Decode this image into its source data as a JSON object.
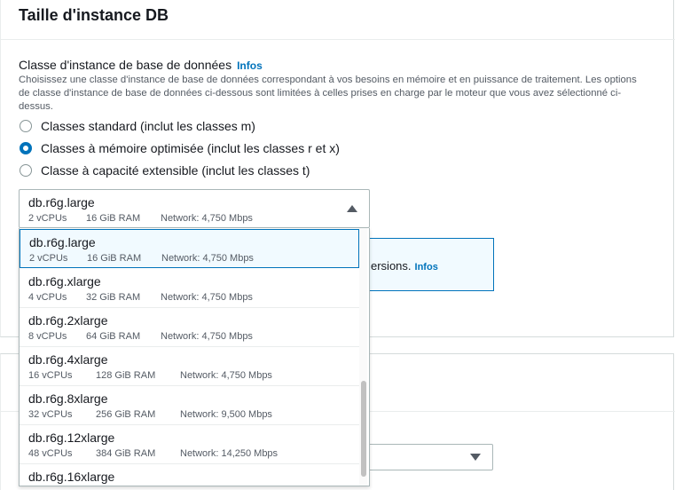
{
  "panel": {
    "title": "Taille d'instance DB",
    "field_label": "Classe d'instance de base de données",
    "info_link": "Infos",
    "description": "Choisissez une classe d'instance de base de données correspondant à vos besoins en mémoire et en puissance de traitement. Les options de classe d'instance de base de données ci-dessous sont limitées à celles prises en charge par le moteur que vous avez sélectionné ci-dessus."
  },
  "radios": [
    {
      "label": "Classes standard (inclut les classes m)",
      "checked": false
    },
    {
      "label": "Classes à mémoire optimisée (inclut les classes r et x)",
      "checked": true
    },
    {
      "label": "Classe à capacité extensible (inclut les classes t)",
      "checked": false
    }
  ],
  "select": {
    "name": "db.r6g.large",
    "vcpu": "2 vCPUs",
    "ram": "16 GiB RAM",
    "network": "Network: 4,750 Mbps"
  },
  "alert": {
    "text": "ersions.",
    "info": "Infos"
  },
  "options": [
    {
      "name": "db.r6g.large",
      "vcpu": "2 vCPUs",
      "ram": "16 GiB RAM",
      "network": "Network: 4,750 Mbps"
    },
    {
      "name": "db.r6g.xlarge",
      "vcpu": "4 vCPUs",
      "ram": "32 GiB RAM",
      "network": "Network: 4,750 Mbps"
    },
    {
      "name": "db.r6g.2xlarge",
      "vcpu": "8 vCPUs",
      "ram": "64 GiB RAM",
      "network": "Network: 4,750 Mbps"
    },
    {
      "name": "db.r6g.4xlarge",
      "vcpu": "16 vCPUs",
      "ram": "128 GiB RAM",
      "network": "Network: 4,750 Mbps"
    },
    {
      "name": "db.r6g.8xlarge",
      "vcpu": "32 vCPUs",
      "ram": "256 GiB RAM",
      "network": "Network: 9,500 Mbps"
    },
    {
      "name": "db.r6g.12xlarge",
      "vcpu": "48 vCPUs",
      "ram": "384 GiB RAM",
      "network": "Network: 14,250 Mbps"
    },
    {
      "name": "db.r6g.16xlarge"
    }
  ],
  "colors": {
    "accent": "#0073bb",
    "selected_bg": "#f1faff"
  }
}
